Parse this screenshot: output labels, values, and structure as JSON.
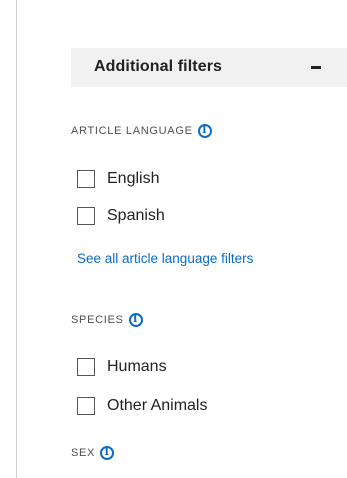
{
  "filters_panel": {
    "title": "Additional filters",
    "collapse_glyph": "minus-icon"
  },
  "sections": [
    {
      "title": "ARTICLE LANGUAGE",
      "info_icon": "info-icon",
      "options": [
        {
          "label": "English",
          "checked": false
        },
        {
          "label": "Spanish",
          "checked": false
        }
      ],
      "see_all_label": "See all article language filters"
    },
    {
      "title": "SPECIES",
      "info_icon": "info-icon",
      "options": [
        {
          "label": "Humans",
          "checked": false
        },
        {
          "label": "Other Animals",
          "checked": false
        }
      ]
    },
    {
      "title": "SEX",
      "info_icon": "info-icon"
    }
  ],
  "colors": {
    "link": "#0b6cc6",
    "header_bg": "#f1f1f1"
  }
}
